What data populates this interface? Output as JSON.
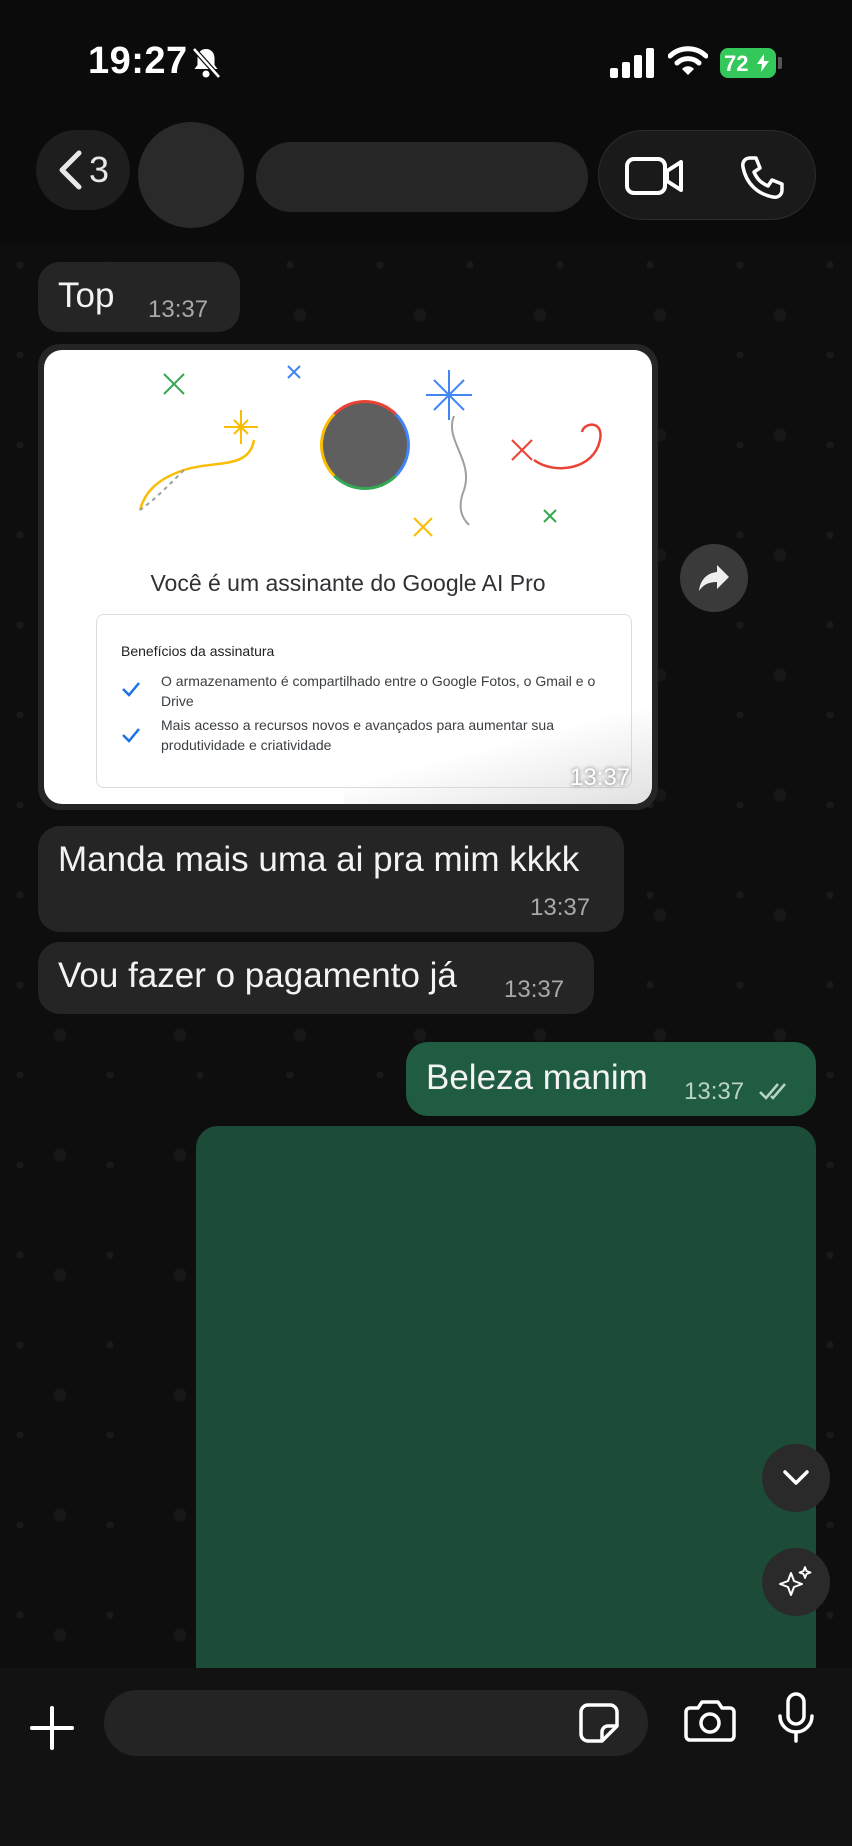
{
  "status_bar": {
    "time": "19:27",
    "battery": "72"
  },
  "header": {
    "back_count": "3"
  },
  "messages": [
    {
      "direction": "incoming",
      "text": "Top",
      "time": "13:37"
    },
    {
      "direction": "incoming",
      "type": "image",
      "time": "13:37",
      "card": {
        "title": "Você é um assinante do Google AI Pro",
        "benefits_heading": "Benefícios da assinatura",
        "benefits": [
          "O armazenamento é compartilhado entre o Google Fotos, o Gmail e o Drive",
          "Mais acesso a recursos novos e avançados para aumentar sua produtividade e criatividade"
        ]
      }
    },
    {
      "direction": "incoming",
      "text": "Manda mais uma ai pra mim kkkk",
      "time": "13:37"
    },
    {
      "direction": "incoming",
      "text": "Vou fazer o pagamento já",
      "time": "13:37"
    },
    {
      "direction": "outgoing",
      "text": "Beleza manim",
      "time": "13:37",
      "status": "read"
    },
    {
      "direction": "outgoing",
      "type": "media"
    }
  ],
  "icons": [
    "bell-slash-icon",
    "signal-icon",
    "wifi-icon",
    "chevron-left-icon",
    "video-call-icon",
    "phone-icon",
    "forward-icon",
    "chevron-down-icon",
    "ai-sparkle-icon",
    "plus-icon",
    "sticker-icon",
    "camera-icon",
    "microphone-icon",
    "double-check-icon"
  ],
  "colors": {
    "outgoing_bubble": "#1f5c41",
    "incoming_bubble": "#252525",
    "battery": "#34c759"
  },
  "input": {
    "value": ""
  }
}
